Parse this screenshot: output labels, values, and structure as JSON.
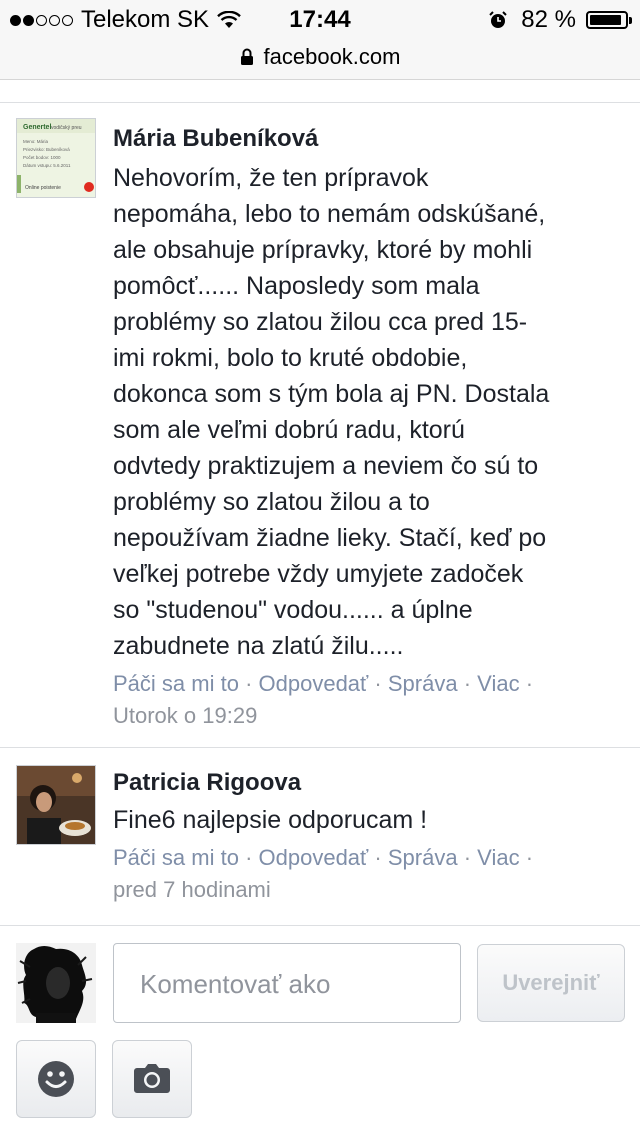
{
  "status_bar": {
    "carrier": "Telekom SK",
    "time": "17:44",
    "battery_percent": "82 %"
  },
  "url_bar": {
    "domain": "facebook.com"
  },
  "comments": [
    {
      "author": "Mária Bubeníková",
      "text": "Nehovorím, že ten prípravok\nnepomáha, lebo to nemám odskúšané,\nale obsahuje prípravky, ktoré by mohli\npomôcť...... Naposledy som mala\nproblémy so zlatou žilou cca pred 15-\nimi rokmi, bolo to kruté obdobie,\ndokonca som s tým bola aj PN. Dostala\nsom ale veľmi dobrú radu, ktorú\nodvtedy praktizujem a neviem čo sú to\nproblémy so zlatou žilou a to\nnepoužívam žiadne lieky. Stačí, keď po\nveľkej potrebe vždy umyjete zadoček\nso \"studenou\" vodou...... a úplne\nzabudnete na zlatú žilu.....",
      "actions": {
        "like": "Páči sa mi to",
        "reply": "Odpovedať",
        "message": "Správa",
        "more": "Viac"
      },
      "timestamp": "Utorok o 19:29",
      "avatar_card": {
        "title": "Genertel",
        "subtitle": "vodičský preu",
        "rows": [
          "Meno: Mária",
          "Priezvisko: Bubeníková",
          "Počet bodov: 1000",
          "Dátum vstupu: 5.6.2011"
        ],
        "footer": "Online poistenie"
      }
    },
    {
      "author": "Patricia Rigoova",
      "text": "Fine6 najlepsie odporucam !",
      "actions": {
        "like": "Páči sa mi to",
        "reply": "Odpovedať",
        "message": "Správa",
        "more": "Viac"
      },
      "timestamp": "pred 7 hodinami"
    }
  ],
  "composer": {
    "placeholder": "Komentovať ako",
    "publish_label": "Uverejniť"
  },
  "separator": "·",
  "colors": {
    "link": "#7f8ea8",
    "meta": "#90949c",
    "icon": "#4b4f56"
  }
}
